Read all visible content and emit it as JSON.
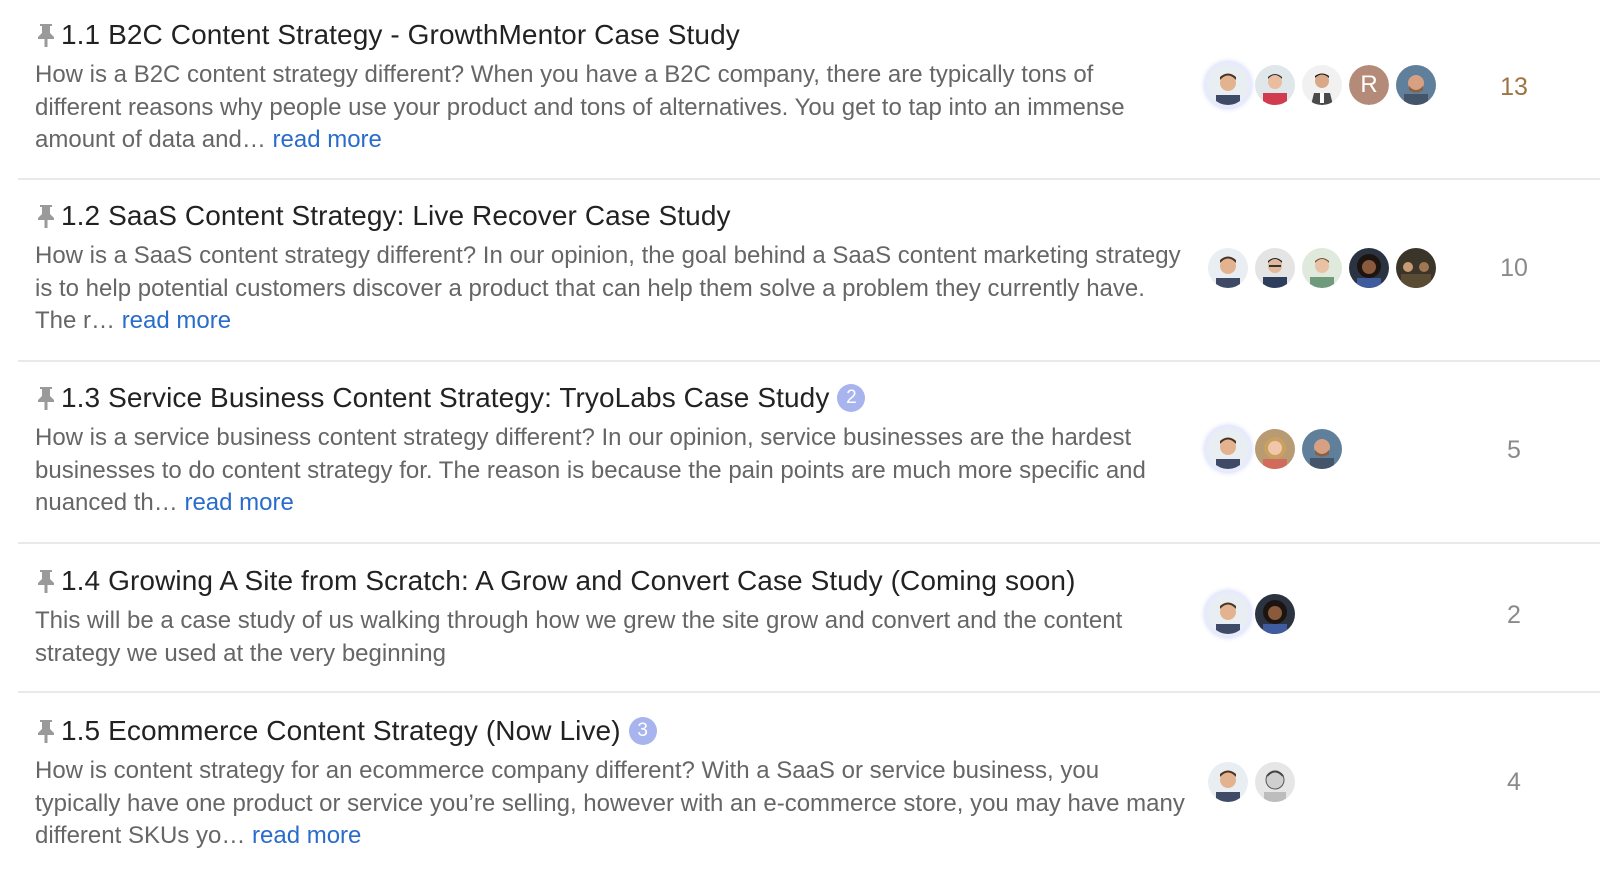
{
  "topics": [
    {
      "title": "1.1 B2C Content Strategy - GrowthMentor Case Study",
      "excerpt": "How is a B2C content strategy different? When you have a B2C company, there are typically tons of different reasons why people use your product and tons of alternatives. You get to tap into an immense amount of data and…",
      "read_more": "read more",
      "badge": "",
      "replies": "13",
      "posters": [
        "man-short-hair-avatar",
        "man-red-shirt-avatar",
        "man-suit-avatar",
        "letter-R-avatar",
        "man-beard-avatar"
      ],
      "letter_avatar": "R"
    },
    {
      "title": "1.2 SaaS Content Strategy: Live Recover Case Study",
      "excerpt": "How is a SaaS content strategy different? In our opinion, the goal behind a SaaS content marketing strategy is to help potential customers discover a product that can help them solve a problem they currently have. The r…",
      "read_more": "read more",
      "badge": "",
      "replies": "10",
      "posters": [
        "man-short-hair-avatar",
        "man-glasses-avatar",
        "man-green-avatar",
        "woman-curly-avatar",
        "group-avatar"
      ]
    },
    {
      "title": "1.3 Service Business Content Strategy: TryoLabs Case Study",
      "excerpt": "How is a service business content strategy different? In our opinion, service businesses are the hardest businesses to do content strategy for. The reason is because the pain points are much more specific and nuanced th…",
      "read_more": "read more",
      "badge": "2",
      "replies": "5",
      "posters": [
        "man-short-hair-avatar",
        "woman-blonde-avatar",
        "man-beard-avatar"
      ]
    },
    {
      "title": "1.4 Growing A Site from Scratch: A Grow and Convert Case Study (Coming soon)",
      "excerpt": "This will be a case study of us walking through how we grew the site grow and convert and the content strategy we used at the very beginning",
      "read_more": "",
      "badge": "",
      "replies": "2",
      "posters": [
        "man-short-hair-avatar",
        "woman-curly-avatar"
      ]
    },
    {
      "title": "1.5 Ecommerce Content Strategy (Now Live)",
      "excerpt": "How is content strategy for an ecommerce company different? With a SaaS or service business, you typically have one product or service you’re selling, however with an e-commerce store, you may have many different SKUs yo…",
      "read_more": "read more",
      "badge": "3",
      "replies": "4",
      "posters": [
        "man-short-hair-avatar",
        "man-sketch-avatar"
      ]
    }
  ],
  "colors": {
    "title": "#222222",
    "excerpt": "#666666",
    "link": "#2a6ccb",
    "badge": "#a8b4ee",
    "hot_count": "#9b7543",
    "count": "#8a8a8a",
    "divider": "#e9e9e9"
  }
}
